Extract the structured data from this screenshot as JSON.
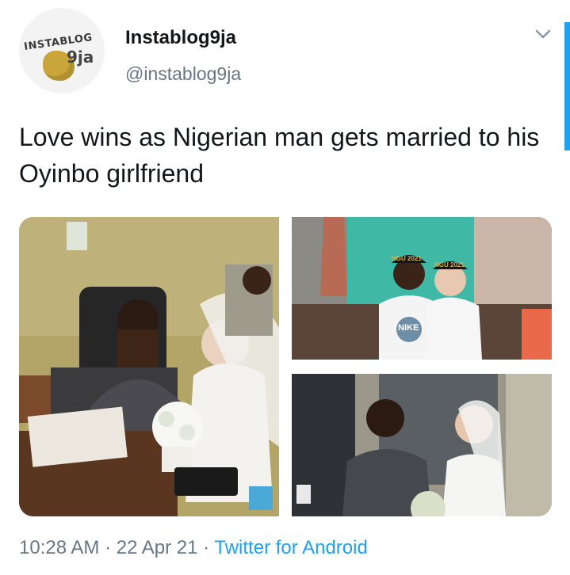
{
  "author": {
    "display_name": "Instablog9ja",
    "handle": "@instablog9ja",
    "avatar_text": "INSTABLOG",
    "avatar_suffix": "9ja"
  },
  "tweet": {
    "text": "Love wins as Nigerian man gets married to his Oyinbo girlfriend",
    "media": {
      "photo2_cap_left": "NGU 2021",
      "photo2_cap_right": "NGU 2021",
      "photo2_shirt": "NIKE"
    }
  },
  "meta": {
    "time": "10:28 AM",
    "separator": " · ",
    "date": "22 Apr 21",
    "source": "Twitter for Android"
  },
  "colors": {
    "accent": "#1da1f2",
    "text": "#14171a",
    "muted": "#657786"
  },
  "icons": {
    "menu": "chevron-down-icon"
  }
}
